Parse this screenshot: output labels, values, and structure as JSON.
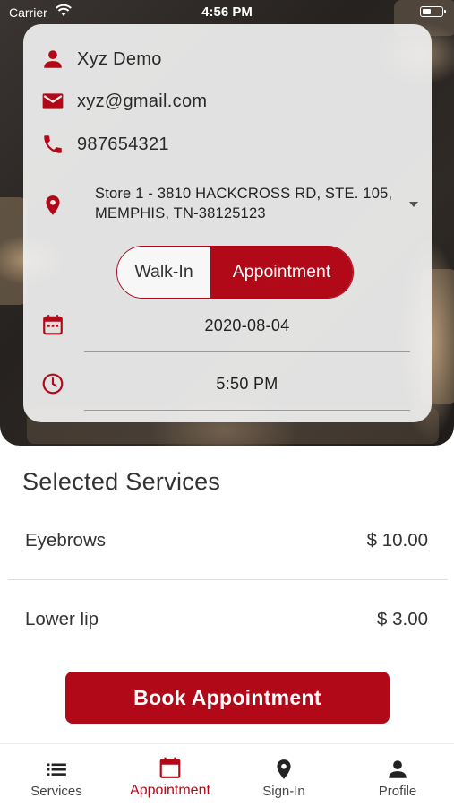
{
  "status_bar": {
    "carrier": "Carrier",
    "time": "4:56 PM"
  },
  "booking_card": {
    "name": "Xyz Demo",
    "email": "xyz@gmail.com",
    "phone": "987654321",
    "store": "Store 1 - 3810 HACKCROSS RD, STE. 105, MEMPHIS, TN-38125123",
    "booking_type": {
      "options": [
        "Walk-In",
        "Appointment"
      ],
      "selected": "Appointment"
    },
    "date": "2020-08-04",
    "time": "5:50 PM"
  },
  "selected_services": {
    "title": "Selected Services",
    "items": [
      {
        "name": "Eyebrows",
        "price": "$ 10.00"
      },
      {
        "name": "Lower lip",
        "price": "$ 3.00"
      }
    ]
  },
  "book_button": {
    "label": "Book Appointment"
  },
  "tab_bar": {
    "tabs": [
      {
        "label": "Services",
        "icon": "list-icon"
      },
      {
        "label": "Appointment",
        "icon": "calendar-icon",
        "active": true
      },
      {
        "label": "Sign-In",
        "icon": "location-pin-icon"
      },
      {
        "label": "Profile",
        "icon": "person-icon"
      }
    ]
  },
  "colors": {
    "accent": "#b20918",
    "text": "#333333"
  }
}
